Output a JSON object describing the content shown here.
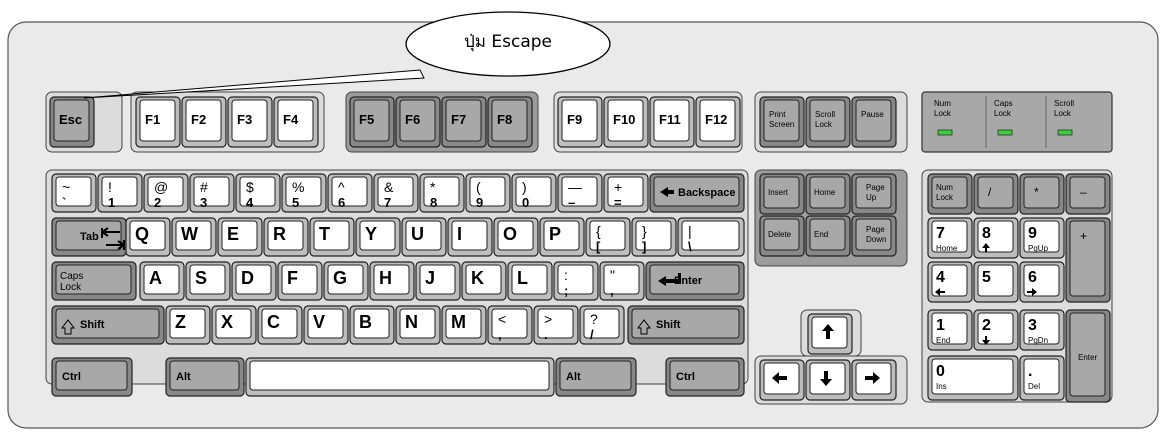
{
  "callout": {
    "text": "ปุ่ม Escape",
    "points_to": "Esc"
  },
  "colors": {
    "case": "#eaeaea",
    "key": "#ffffff",
    "key_dark": "#a8a8a8",
    "led": "#3ccf3c"
  },
  "function_row": [
    "Esc",
    "F1",
    "F2",
    "F3",
    "F4",
    "F5",
    "F6",
    "F7",
    "F8",
    "F9",
    "F10",
    "F11",
    "F12",
    "Print Screen",
    "Scroll Lock",
    "Pause"
  ],
  "lock_lights": [
    "Num Lock",
    "Caps Lock",
    "Scroll Lock"
  ],
  "main_keys": [
    {
      "id": "tilde",
      "top": "~",
      "bottom": "`"
    },
    {
      "id": "1",
      "top": "!",
      "bottom": "1"
    },
    {
      "id": "2",
      "top": "@",
      "bottom": "2"
    },
    {
      "id": "3",
      "top": "#",
      "bottom": "3"
    },
    {
      "id": "4",
      "top": "$",
      "bottom": "4"
    },
    {
      "id": "5",
      "top": "%",
      "bottom": "5"
    },
    {
      "id": "6",
      "top": "^",
      "bottom": "6"
    },
    {
      "id": "7",
      "top": "&",
      "bottom": "7"
    },
    {
      "id": "8",
      "top": "*",
      "bottom": "8"
    },
    {
      "id": "9",
      "top": "(",
      "bottom": "9"
    },
    {
      "id": "0",
      "top": ")",
      "bottom": "0"
    },
    {
      "id": "minus",
      "top": "—",
      "bottom": "–"
    },
    {
      "id": "equals",
      "top": "+",
      "bottom": "="
    },
    {
      "id": "backspace",
      "label": "Backspace",
      "icon": "back-arrow"
    },
    {
      "id": "tab",
      "label": "Tab",
      "icon": "tab-arrows"
    },
    {
      "id": "q",
      "label": "Q"
    },
    {
      "id": "w",
      "label": "W"
    },
    {
      "id": "e",
      "label": "E"
    },
    {
      "id": "r",
      "label": "R"
    },
    {
      "id": "t",
      "label": "T"
    },
    {
      "id": "y",
      "label": "Y"
    },
    {
      "id": "u",
      "label": "U"
    },
    {
      "id": "i",
      "label": "I"
    },
    {
      "id": "o",
      "label": "O"
    },
    {
      "id": "p",
      "label": "P"
    },
    {
      "id": "lbracket",
      "top": "{",
      "bottom": "["
    },
    {
      "id": "rbracket",
      "top": "}",
      "bottom": "]"
    },
    {
      "id": "backslash",
      "top": "|",
      "bottom": "\\"
    },
    {
      "id": "capslock",
      "label": "Caps Lock"
    },
    {
      "id": "a",
      "label": "A"
    },
    {
      "id": "s",
      "label": "S"
    },
    {
      "id": "d",
      "label": "D"
    },
    {
      "id": "f",
      "label": "F"
    },
    {
      "id": "g",
      "label": "G"
    },
    {
      "id": "h",
      "label": "H"
    },
    {
      "id": "j",
      "label": "J"
    },
    {
      "id": "k",
      "label": "K"
    },
    {
      "id": "l",
      "label": "L"
    },
    {
      "id": "semicolon",
      "top": ":",
      "bottom": ";"
    },
    {
      "id": "quote",
      "top": "\"",
      "bottom": ","
    },
    {
      "id": "enter",
      "label": "Enter",
      "icon": "enter-arrow"
    },
    {
      "id": "lshift",
      "label": "Shift",
      "icon": "shift-arrow"
    },
    {
      "id": "z",
      "label": "Z"
    },
    {
      "id": "x",
      "label": "X"
    },
    {
      "id": "c",
      "label": "C"
    },
    {
      "id": "v",
      "label": "V"
    },
    {
      "id": "b",
      "label": "B"
    },
    {
      "id": "n",
      "label": "N"
    },
    {
      "id": "m",
      "label": "M"
    },
    {
      "id": "comma",
      "top": "<",
      "bottom": ","
    },
    {
      "id": "period",
      "top": ">",
      "bottom": "."
    },
    {
      "id": "slash",
      "top": "?",
      "bottom": "/"
    },
    {
      "id": "rshift",
      "label": "Shift",
      "icon": "shift-arrow"
    },
    {
      "id": "lctrl",
      "label": "Ctrl"
    },
    {
      "id": "lalt",
      "label": "Alt"
    },
    {
      "id": "space",
      "label": ""
    },
    {
      "id": "ralt",
      "label": "Alt"
    },
    {
      "id": "rctrl",
      "label": "Ctrl"
    }
  ],
  "edit_keys": [
    "Insert",
    "Home",
    "Page Up",
    "Delete",
    "End",
    "Page Down"
  ],
  "arrow_keys": [
    "up",
    "left",
    "down",
    "right"
  ],
  "numpad": [
    {
      "id": "numlock",
      "label": "Num Lock"
    },
    {
      "id": "divide",
      "label": "/"
    },
    {
      "id": "multiply",
      "label": "*"
    },
    {
      "id": "subtract",
      "label": "–"
    },
    {
      "id": "np7",
      "main": "7",
      "sub": "Home"
    },
    {
      "id": "np8",
      "main": "8",
      "icon": "up"
    },
    {
      "id": "np9",
      "main": "9",
      "sub": "PgUp"
    },
    {
      "id": "add",
      "label": "+"
    },
    {
      "id": "np4",
      "main": "4",
      "icon": "left"
    },
    {
      "id": "np5",
      "main": "5"
    },
    {
      "id": "np6",
      "main": "6",
      "icon": "right"
    },
    {
      "id": "np1",
      "main": "1",
      "sub": "End"
    },
    {
      "id": "np2",
      "main": "2",
      "icon": "down"
    },
    {
      "id": "np3",
      "main": "3",
      "sub": "PgDn"
    },
    {
      "id": "npenter",
      "label": "Enter"
    },
    {
      "id": "np0",
      "main": "0",
      "sub": "Ins"
    },
    {
      "id": "npdot",
      "main": ".",
      "sub": "Del"
    }
  ]
}
